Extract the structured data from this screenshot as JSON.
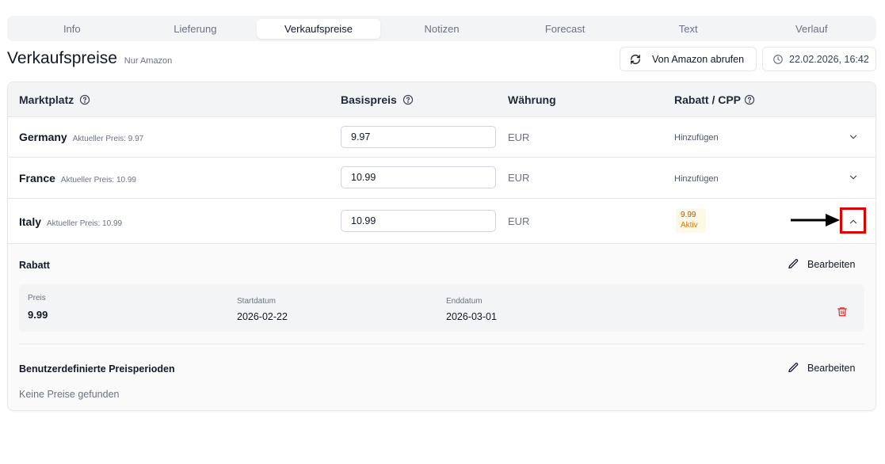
{
  "tabs": [
    "Info",
    "Lieferung",
    "Verkaufspreise",
    "Notizen",
    "Forecast",
    "Text",
    "Verlauf"
  ],
  "active_tab": "Verkaufspreise",
  "header": {
    "title": "Verkaufspreise",
    "subtitle": "Nur Amazon",
    "fetch_button": "Von Amazon abrufen",
    "timestamp": "22.02.2026, 16:42"
  },
  "table": {
    "columns": {
      "marketplace": "Marktplatz",
      "base_price": "Basispreis",
      "currency": "Währung",
      "discount": "Rabatt / CPP"
    },
    "rows": [
      {
        "country": "Germany",
        "current": "Aktueller Preis: 9.97",
        "price": "9.97",
        "currency": "EUR",
        "discount_action": "Hinzufügen",
        "expanded": false
      },
      {
        "country": "France",
        "current": "Aktueller Preis: 10.99",
        "price": "10.99",
        "currency": "EUR",
        "discount_action": "Hinzufügen",
        "expanded": false
      },
      {
        "country": "Italy",
        "current": "Aktueller Preis: 10.99",
        "price": "10.99",
        "currency": "EUR",
        "badge_price": "9.99",
        "badge_status": "Aktiv",
        "expanded": true
      }
    ]
  },
  "detail": {
    "discount_title": "Rabatt",
    "edit_label": "Bearbeiten",
    "price_label": "Preis",
    "price_value": "9.99",
    "start_label": "Startdatum",
    "start_value": "2026-02-22",
    "end_label": "Enddatum",
    "end_value": "2026-03-01",
    "custom_title": "Benutzerdefinierte Preisperioden",
    "custom_empty": "Keine Preise gefunden"
  },
  "colors": {
    "highlight": "#e00000",
    "badge_bg": "#fef9e7",
    "badge_text": "#b45309",
    "delete": "#dc2626"
  }
}
